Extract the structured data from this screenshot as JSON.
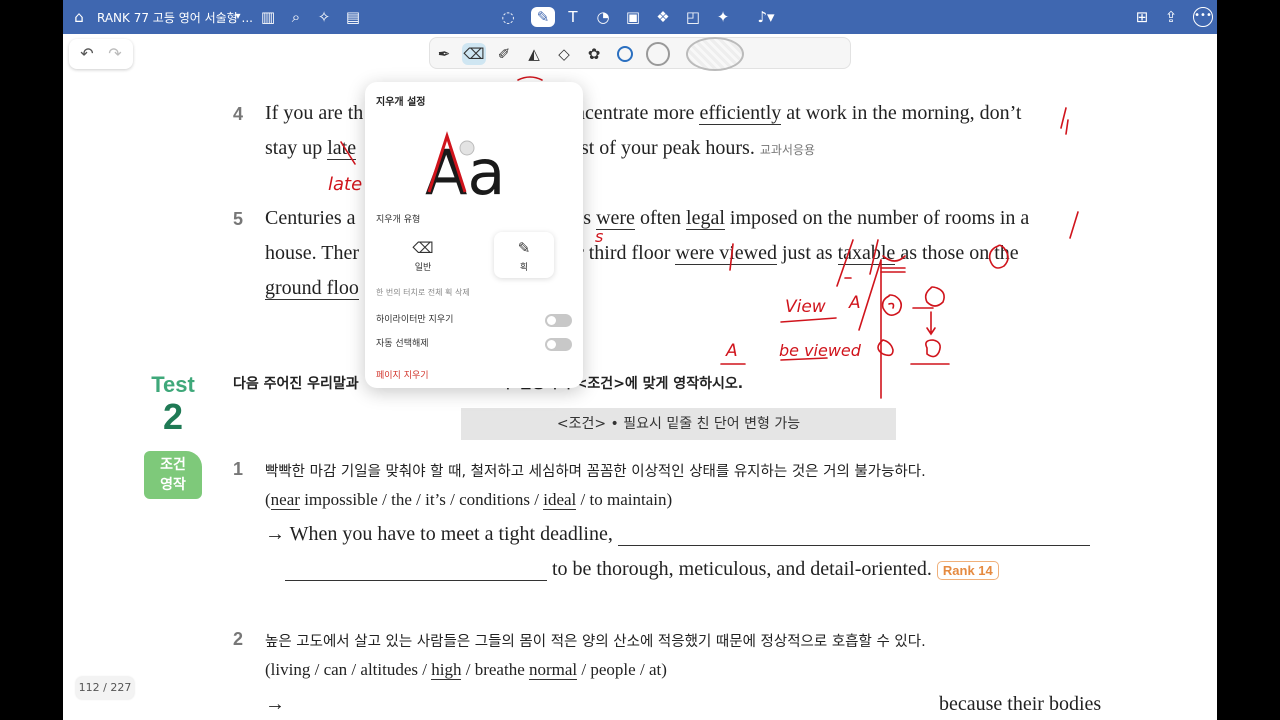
{
  "app": {
    "doc_title": "RANK 77 고등 영어 서술형 ...",
    "accent": "#3f67b0",
    "ink_color": "#d0141c",
    "page_indicator": "112 / 227"
  },
  "topbar": {
    "left_icons": [
      "home-icon",
      "chevron-down-icon",
      "sidebar-icon",
      "search-icon",
      "magic-icon",
      "document-icon"
    ],
    "center_icons": [
      "lasso-icon",
      "pen-icon",
      "textbox-icon",
      "shapes-icon",
      "image-icon",
      "elements-icon",
      "sticker-icon",
      "laser-icon",
      "mic-icon"
    ],
    "right_icons": [
      "add-page-icon",
      "share-icon",
      "close-icon",
      "more-icon"
    ]
  },
  "palette": {
    "tools": [
      "pen-tool-icon",
      "eraser-tool-icon",
      "highlighter-tool-icon",
      "fill-tool-icon",
      "shape-tool-icon",
      "sticker-tool-icon"
    ],
    "selected": "eraser-tool-icon",
    "sizes": [
      "small",
      "medium",
      "large"
    ]
  },
  "q4": {
    "num": "4",
    "line1_pre": "If you are th",
    "line1_post1": "an concentrate more ",
    "line1_u": "efficiently",
    "line1_post2": " at work in the morning, don’t",
    "line2_pre": "stay up ",
    "line2_u": "late",
    "line2_post": "ke the most of your peak hours.",
    "source": "교과서응용"
  },
  "q5": {
    "num": "5",
    "line1_pre": "Centuries a",
    "line1_mid": "axes ",
    "line1_u1": "were",
    "line1_mid2": " often ",
    "line1_u2": "legal",
    "line1_post": " imposed on the number of rooms in a",
    "line2_pre": "house. Ther",
    "line2_mid": "ond or third floor ",
    "line2_u1": "were viewed",
    "line2_mid2": " just as ",
    "line2_u2": "taxable",
    "line2_post": " as those on the",
    "line3_u": "ground floo"
  },
  "instruction": {
    "pre": "다음 주어진 우리말과",
    "post": "모두 활용하여 <조건>에 맞게 영작하시오."
  },
  "test": {
    "label": "Test",
    "number": "2",
    "tab_line1": "조건",
    "tab_line2": "영작"
  },
  "condition": "<조건>  •  필요시 밑줄 친 단어 변형 가능",
  "p1": {
    "num": "1",
    "korean": "빡빡한 마감 기일을 맞춰야 할 때, 철저하고 세심하며 꼼꼼한 이상적인 상태를 유지하는 것은 거의 불가능하다.",
    "hint_words": [
      "near",
      "impossible",
      "the",
      "it’s",
      "conditions",
      "ideal",
      "to maintain"
    ],
    "arrow_text": "→ When you have to meet a tight deadline,",
    "line2_text": "to be thorough, meticulous, and detail-oriented.",
    "rank": "Rank 14"
  },
  "p2": {
    "num": "2",
    "korean": "높은 고도에서 살고 있는 사람들은 그들의 몸이 적은 양의 산소에 적응했기 때문에 정상적으로 호흡할 수 있다.",
    "hint_words": [
      "living",
      "can",
      "altitudes",
      "high",
      "breathe",
      "normal",
      "people",
      "at"
    ],
    "arrow": "→",
    "line_end": "because their bodies"
  },
  "handwriting": {
    "note1": "late",
    "note2": "s",
    "view": "View",
    "a1": "A",
    "be_viewed": "be viewed",
    "a2": "A",
    "as": "as",
    "b": "B"
  },
  "eraser_popup": {
    "title": "지우개 설정",
    "sample": "Aa",
    "type_title": "지우개 유형",
    "type_normal": "일반",
    "type_stroke": "획",
    "type_desc": "한 번의 터치로 전체 획 삭제",
    "toggle_highlighter": "하이라이터만 지우기",
    "toggle_autodeselect": "자동 선택해제",
    "clear_page": "페이지 지우기"
  }
}
